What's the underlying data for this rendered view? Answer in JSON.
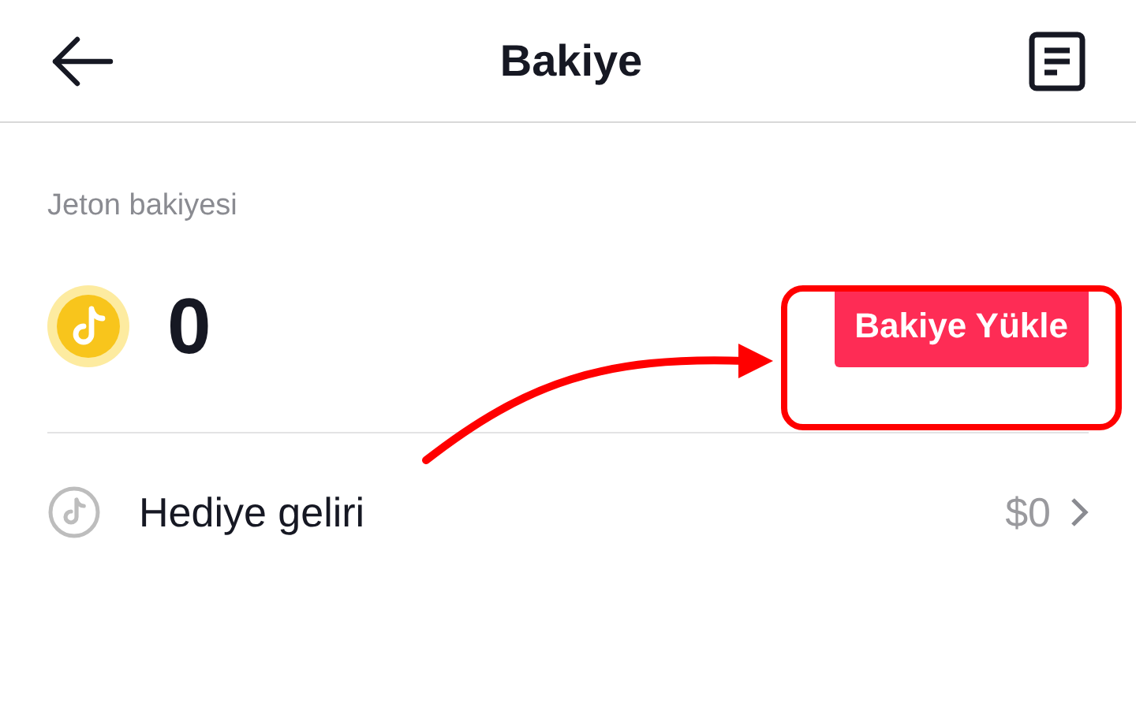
{
  "header": {
    "title": "Bakiye"
  },
  "balance": {
    "label": "Jeton bakiyesi",
    "amount": "0",
    "button": "Bakiye Yükle"
  },
  "rows": [
    {
      "label": "Hediye geliri",
      "value": "$0"
    }
  ]
}
